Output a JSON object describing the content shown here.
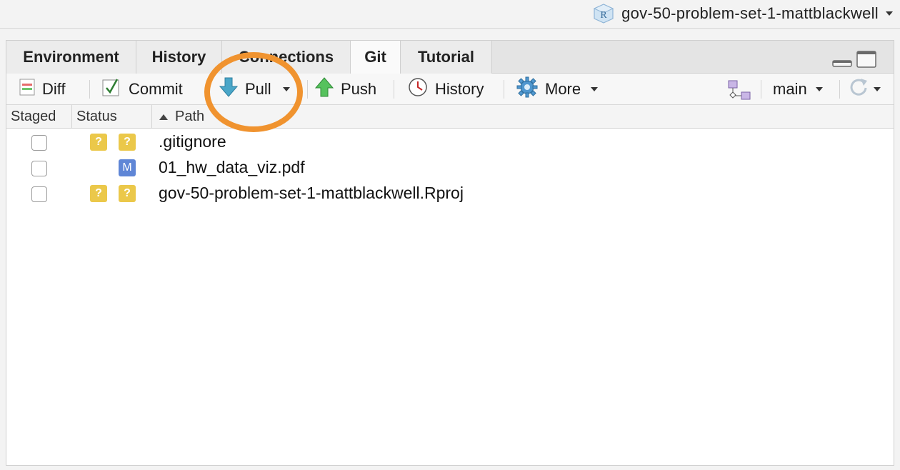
{
  "project": {
    "name": "gov-50-problem-set-1-mattblackwell",
    "icon": "r-project-icon"
  },
  "tabs": [
    {
      "label": "Environment",
      "active": false
    },
    {
      "label": "History",
      "active": false
    },
    {
      "label": "Connections",
      "active": false
    },
    {
      "label": "Git",
      "active": true
    },
    {
      "label": "Tutorial",
      "active": false
    }
  ],
  "toolbar": {
    "diff": "Diff",
    "commit": "Commit",
    "pull": "Pull",
    "push": "Push",
    "history": "History",
    "more": "More",
    "branch": "main"
  },
  "columns": {
    "staged": "Staged",
    "status": "Status",
    "path": "Path",
    "sort_icon": "sort-ascending-icon"
  },
  "files": [
    {
      "staged": false,
      "status_index": "?",
      "status_worktree": "?",
      "path": ".gitignore"
    },
    {
      "staged": false,
      "status_index": "",
      "status_worktree": "M",
      "path": "01_hw_data_viz.pdf"
    },
    {
      "staged": false,
      "status_index": "?",
      "status_worktree": "?",
      "path": "gov-50-problem-set-1-mattblackwell.Rproj"
    }
  ],
  "colors": {
    "highlight_ring": "#f0932f",
    "untracked_badge": "#ebc84a",
    "modified_badge": "#5f86d6"
  }
}
